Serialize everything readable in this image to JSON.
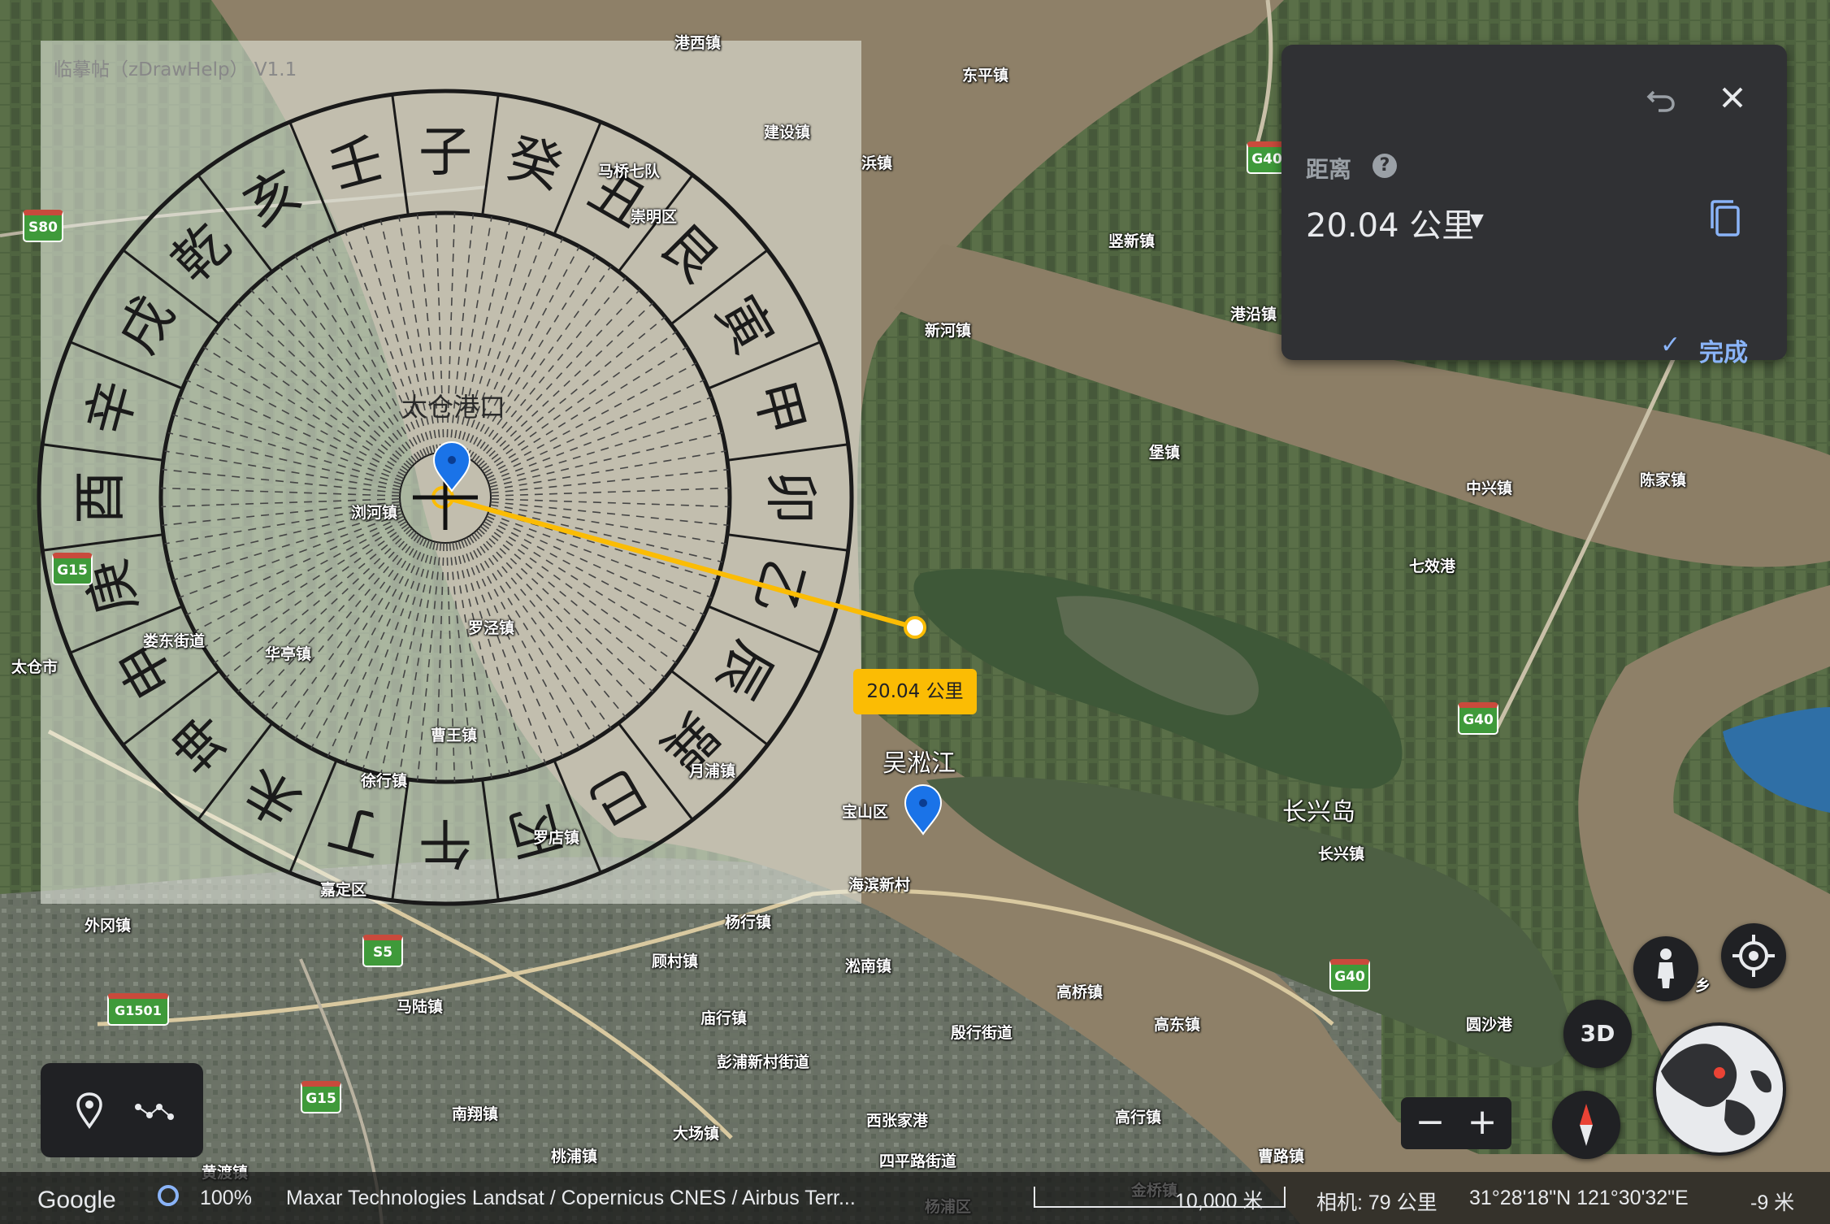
{
  "overlay": {
    "title": "临摹帖（zDrawHelp） V1.1",
    "inner_ring": [
      "子",
      "癸",
      "丑",
      "艮",
      "寅",
      "甲",
      "卯",
      "乙",
      "辰",
      "巽",
      "巳",
      "丙",
      "午",
      "丁",
      "未",
      "坤",
      "申",
      "庚",
      "酉",
      "辛",
      "戌",
      "乾",
      "亥",
      "壬"
    ],
    "center_label": "太仓港口"
  },
  "measure_panel": {
    "label": "距离",
    "value": "20.04 公里",
    "done_label": "完成",
    "icons": [
      "undo-icon",
      "close-icon",
      "help-icon",
      "caret-down-icon",
      "copy-icon",
      "check-icon"
    ]
  },
  "distance_chip": "20.04 公里",
  "map_labels": {
    "places": [
      {
        "text": "港西镇"
      },
      {
        "text": "东平镇"
      },
      {
        "text": "建设镇"
      },
      {
        "text": "马桥七队"
      },
      {
        "text": "崇明区"
      },
      {
        "text": "竖新镇"
      },
      {
        "text": "港沿镇"
      },
      {
        "text": "新河镇"
      },
      {
        "text": "堡镇"
      },
      {
        "text": "中兴镇"
      },
      {
        "text": "陈家镇"
      },
      {
        "text": "七效港"
      },
      {
        "text": "浏河镇"
      },
      {
        "text": "罗泾镇"
      },
      {
        "text": "娄东街道"
      },
      {
        "text": "华亭镇"
      },
      {
        "text": "太仓市"
      },
      {
        "text": "曹王镇"
      },
      {
        "text": "徐行镇"
      },
      {
        "text": "月浦镇"
      },
      {
        "text": "罗店镇"
      },
      {
        "text": "嘉定区"
      },
      {
        "text": "外冈镇"
      },
      {
        "text": "宝山区"
      },
      {
        "text": "海滨新村"
      },
      {
        "text": "杨行镇"
      },
      {
        "text": "顾村镇"
      },
      {
        "text": "淞南镇"
      },
      {
        "text": "马陆镇"
      },
      {
        "text": "庙行镇"
      },
      {
        "text": "彭浦新村街道"
      },
      {
        "text": "殷行街道"
      },
      {
        "text": "高桥镇"
      },
      {
        "text": "高东镇"
      },
      {
        "text": "长兴镇"
      },
      {
        "text": "圆沙港"
      },
      {
        "text": "南翔镇"
      },
      {
        "text": "大场镇"
      },
      {
        "text": "西张家港"
      },
      {
        "text": "高行镇"
      },
      {
        "text": "桃浦镇"
      },
      {
        "text": "黄渡镇"
      },
      {
        "text": "四平路街道"
      },
      {
        "text": "曹路镇"
      },
      {
        "text": "杨浦区"
      },
      {
        "text": "金桥镇"
      },
      {
        "text": "浜镇"
      },
      {
        "text": "乡"
      }
    ],
    "big": [
      {
        "text": "吴淞江"
      },
      {
        "text": "长兴岛"
      }
    ],
    "shields": [
      "S80",
      "G40",
      "G15",
      "G40",
      "G40",
      "S5",
      "G1501",
      "G15"
    ]
  },
  "controls": {
    "three_d_label": "3D",
    "zoom_minus": "−",
    "zoom_plus": "+",
    "icons": [
      "place-pin-icon",
      "path-icon",
      "pegman-icon",
      "my-location-icon",
      "compass-icon",
      "globe-icon"
    ]
  },
  "status_bar": {
    "logo": "Google",
    "zoom_pct": "100%",
    "attribution": "Maxar Technologies   Landsat / Copernicus   CNES / Airbus   Terr...",
    "scale": "10,000 米",
    "camera": "相机:  79 公里",
    "coords": "31°28'18\"N 121°30'32\"E",
    "elevation": "-9 米"
  },
  "colors": {
    "panel_bg": "#303134",
    "accent_blue": "#8ab4f8",
    "measure_line": "#fbbc04",
    "shield_green": "#3f9a3a"
  }
}
